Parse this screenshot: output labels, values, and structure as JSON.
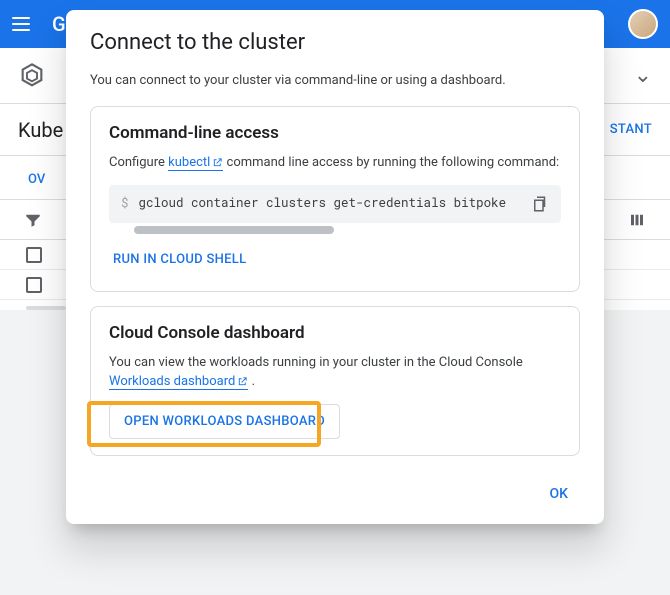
{
  "topbar": {
    "logo_prefix": "G"
  },
  "secondbar": {
    "title_partial": "Kube"
  },
  "assistant_button_partial": "STANT",
  "tabs": {
    "tab1_partial": "OV"
  },
  "modal": {
    "title": "Connect to the cluster",
    "description": "You can connect to your cluster via command-line or using a dashboard.",
    "cli": {
      "heading": "Command-line access",
      "configure_prefix": "Configure ",
      "kubectl_link": "kubectl",
      "configure_suffix": " command line access by running the following command:",
      "prompt": "$",
      "command": "gcloud container clusters get-credentials bitpoke",
      "run_button": "RUN IN CLOUD SHELL"
    },
    "console": {
      "heading": "Cloud Console dashboard",
      "text_prefix": "You can view the workloads running in your cluster in the Cloud Console ",
      "workloads_link": "Workloads dashboard",
      "text_suffix": " .",
      "open_button": "OPEN WORKLOADS DASHBOARD"
    },
    "ok": "OK"
  }
}
